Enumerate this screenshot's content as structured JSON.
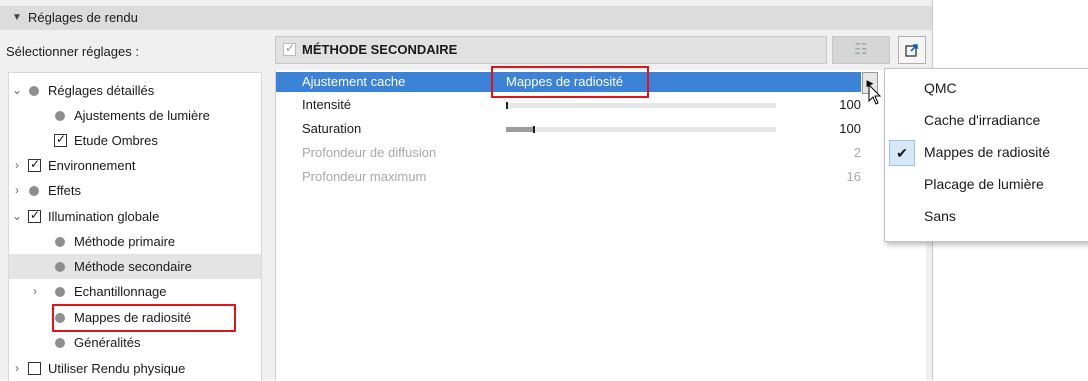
{
  "panel": {
    "title": "Réglages de rendu",
    "select_label": "Sélectionner réglages :"
  },
  "tree": {
    "items": [
      {
        "label": "Réglages détaillés",
        "chevron": "down",
        "marker": "dot"
      },
      {
        "label": "Ajustements de lumière",
        "chevron": "",
        "marker": "dot"
      },
      {
        "label": "Etude Ombres",
        "chevron": "",
        "marker": "checked"
      },
      {
        "label": "Environnement",
        "chevron": "right",
        "marker": "checked"
      },
      {
        "label": "Effets",
        "chevron": "right",
        "marker": "dot"
      },
      {
        "label": "Illumination globale",
        "chevron": "down",
        "marker": "checked"
      },
      {
        "label": "Méthode primaire",
        "chevron": "",
        "marker": "dot"
      },
      {
        "label": "Méthode secondaire",
        "chevron": "",
        "marker": "dot",
        "selected": true
      },
      {
        "label": "Echantillonnage",
        "chevron": "right",
        "marker": "dot"
      },
      {
        "label": "Mappes de radiosité",
        "chevron": "",
        "marker": "dot",
        "highlighted": true
      },
      {
        "label": "Généralités",
        "chevron": "",
        "marker": "dot"
      },
      {
        "label": "Utiliser Rendu physique",
        "chevron": "right",
        "marker": "unchecked"
      }
    ]
  },
  "method": {
    "title": "MÉTHODE SECONDAIRE"
  },
  "params": {
    "cache_label": "Ajustement cache",
    "cache_value": "Mappes de radiosité",
    "rows": [
      {
        "label": "Intensité",
        "value": "100",
        "level": 0.0
      },
      {
        "label": "Saturation",
        "value": "100",
        "level": 0.1
      },
      {
        "label": "Profondeur de diffusion",
        "value": "2",
        "disabled": true
      },
      {
        "label": "Profondeur maximum",
        "value": "16",
        "disabled": true
      }
    ]
  },
  "dropdown": {
    "options": [
      {
        "label": "QMC",
        "checked": false
      },
      {
        "label": "Cache d'irradiance",
        "checked": false
      },
      {
        "label": "Mappes de radiosité",
        "checked": true
      },
      {
        "label": "Placage de lumière",
        "checked": false
      },
      {
        "label": "Sans",
        "checked": false
      }
    ],
    "check_glyph": "✔"
  },
  "colors": {
    "highlight": "#3c83d7",
    "red_frame": "#e0141b"
  },
  "icons": {
    "list_button": "list-settings-icon",
    "export_button": "export-icon",
    "arrow_button": "triangle-right-icon"
  }
}
